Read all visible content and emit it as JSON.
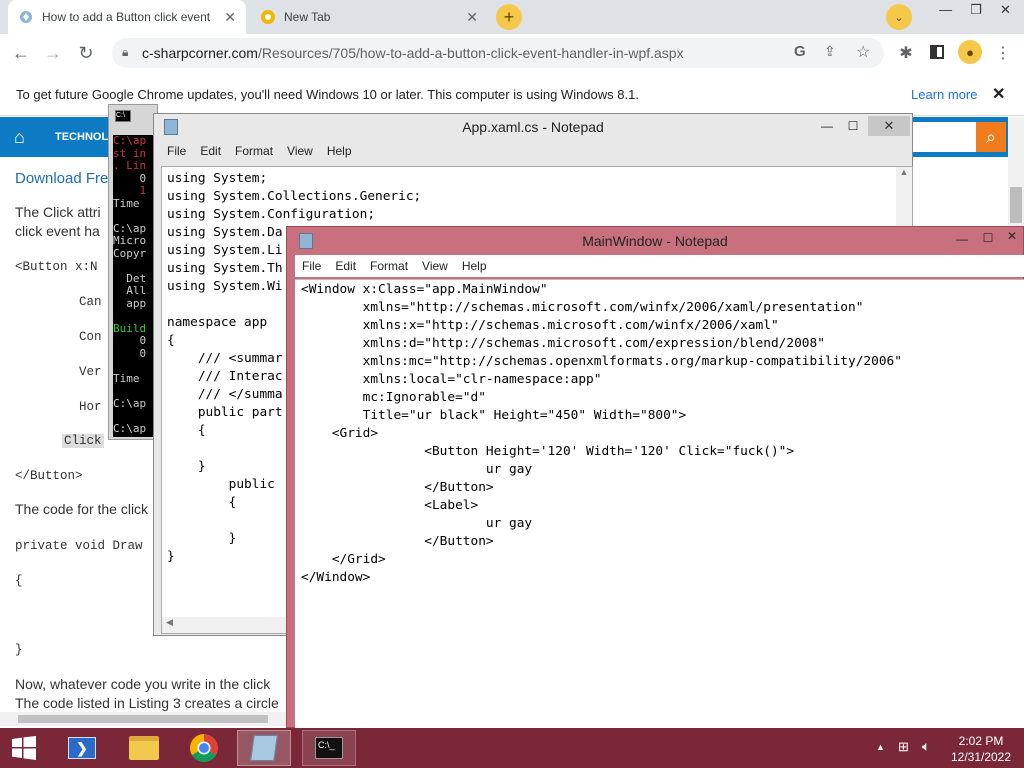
{
  "browser": {
    "tabs": [
      {
        "title": "How to add a Button click event"
      },
      {
        "title": "New Tab"
      }
    ],
    "url_host": "c-sharpcorner.com",
    "url_path": "/Resources/705/how-to-add-a-button-click-event-handler-in-wpf.aspx",
    "infobar": {
      "message": "To get future Google Chrome updates, you'll need Windows 10 or later. This computer is using Windows 8.1.",
      "link": "Learn more"
    }
  },
  "page": {
    "nav_label": "TECHNOLOG",
    "download_link": "Download Fre",
    "para1_line1": "The Click attri",
    "para1_line2": "click event ha",
    "code1": {
      "open": "<Button x:N",
      "l1": "Can",
      "l2": "Con",
      "l3": "Ver",
      "l4": "Hor",
      "l5": "Click",
      "close": "</Button>"
    },
    "para2": "The code for the click",
    "code2_line": "private void Draw",
    "brace_open": "{",
    "brace_close": "}",
    "para3_line1": "Now, whatever code you write in the click",
    "para3_line2": "The code listed in Listing 3 creates a circle"
  },
  "cmd": {
    "lines": [
      {
        "t": "C:\\ap",
        "c": "#c33"
      },
      {
        "t": "st in",
        "c": "#c33"
      },
      {
        "t": ". Lin",
        "c": "#c33"
      },
      {
        "t": "    0",
        "c": "#ccc"
      },
      {
        "t": "    1",
        "c": "#c33"
      },
      {
        "t": "Time",
        "c": "#ccc"
      },
      {
        "t": "",
        "c": "#ccc"
      },
      {
        "t": "C:\\ap",
        "c": "#ccc"
      },
      {
        "t": "Micro",
        "c": "#ccc"
      },
      {
        "t": "Copyr",
        "c": "#ccc"
      },
      {
        "t": "",
        "c": "#ccc"
      },
      {
        "t": "  Det",
        "c": "#ccc"
      },
      {
        "t": "  All",
        "c": "#ccc"
      },
      {
        "t": "  app",
        "c": "#ccc"
      },
      {
        "t": "",
        "c": "#ccc"
      },
      {
        "t": "Build",
        "c": "#3c3"
      },
      {
        "t": "    0",
        "c": "#ccc"
      },
      {
        "t": "    0",
        "c": "#ccc"
      },
      {
        "t": "",
        "c": "#ccc"
      },
      {
        "t": "Time",
        "c": "#ccc"
      },
      {
        "t": "",
        "c": "#ccc"
      },
      {
        "t": "C:\\ap",
        "c": "#ccc"
      },
      {
        "t": "",
        "c": "#ccc"
      },
      {
        "t": "C:\\ap",
        "c": "#ccc"
      }
    ]
  },
  "notepad_back": {
    "title": "App.xaml.cs - Notepad",
    "menu": [
      "File",
      "Edit",
      "Format",
      "View",
      "Help"
    ],
    "text": "using System;\nusing System.Collections.Generic;\nusing System.Configuration;\nusing System.Da\nusing System.Li\nusing System.Th\nusing System.Wi\n\nnamespace app\n{\n    /// <summar\n    /// Interac\n    /// </summa\n    public part\n    {\n\n    }\n        public\n        {\n\n        }\n}"
  },
  "notepad_front": {
    "title": "MainWindow - Notepad",
    "menu": [
      "File",
      "Edit",
      "Format",
      "View",
      "Help"
    ],
    "text": "<Window x:Class=\"app.MainWindow\"\n        xmlns=\"http://schemas.microsoft.com/winfx/2006/xaml/presentation\"\n        xmlns:x=\"http://schemas.microsoft.com/winfx/2006/xaml\"\n        xmlns:d=\"http://schemas.microsoft.com/expression/blend/2008\"\n        xmlns:mc=\"http://schemas.openxmlformats.org/markup-compatibility/2006\"\n        xmlns:local=\"clr-namespace:app\"\n        mc:Ignorable=\"d\"\n        Title=\"ur black\" Height=\"450\" Width=\"800\">\n    <Grid>\n                <Button Height='120' Width='120' Click=\"fuck()\">\n                        ur gay\n                </Button>\n                <Label>\n                        ur gay\n                </Button>\n    </Grid>\n</Window>"
  },
  "taskbar": {
    "time": "2:02 PM",
    "date": "12/31/2022"
  },
  "colors": {
    "site_blue": "#0d7bc4",
    "search_orange": "#f07c1e",
    "taskbar": "#7a2838",
    "active_titlebar": "#c8707e"
  },
  "icons": [
    "tab-favicon-icon",
    "chrome-favicon-icon",
    "new-tab-icon",
    "back-icon",
    "forward-icon",
    "reload-icon",
    "lock-icon",
    "google-icon",
    "share-icon",
    "star-icon",
    "extensions-icon",
    "sidebar-icon",
    "profile-icon",
    "menu-icon",
    "home-icon",
    "search-icon",
    "notepad-icon",
    "cmd-icon",
    "start-icon",
    "powershell-icon",
    "explorer-icon",
    "chrome-icon",
    "network-icon",
    "volume-icon"
  ]
}
